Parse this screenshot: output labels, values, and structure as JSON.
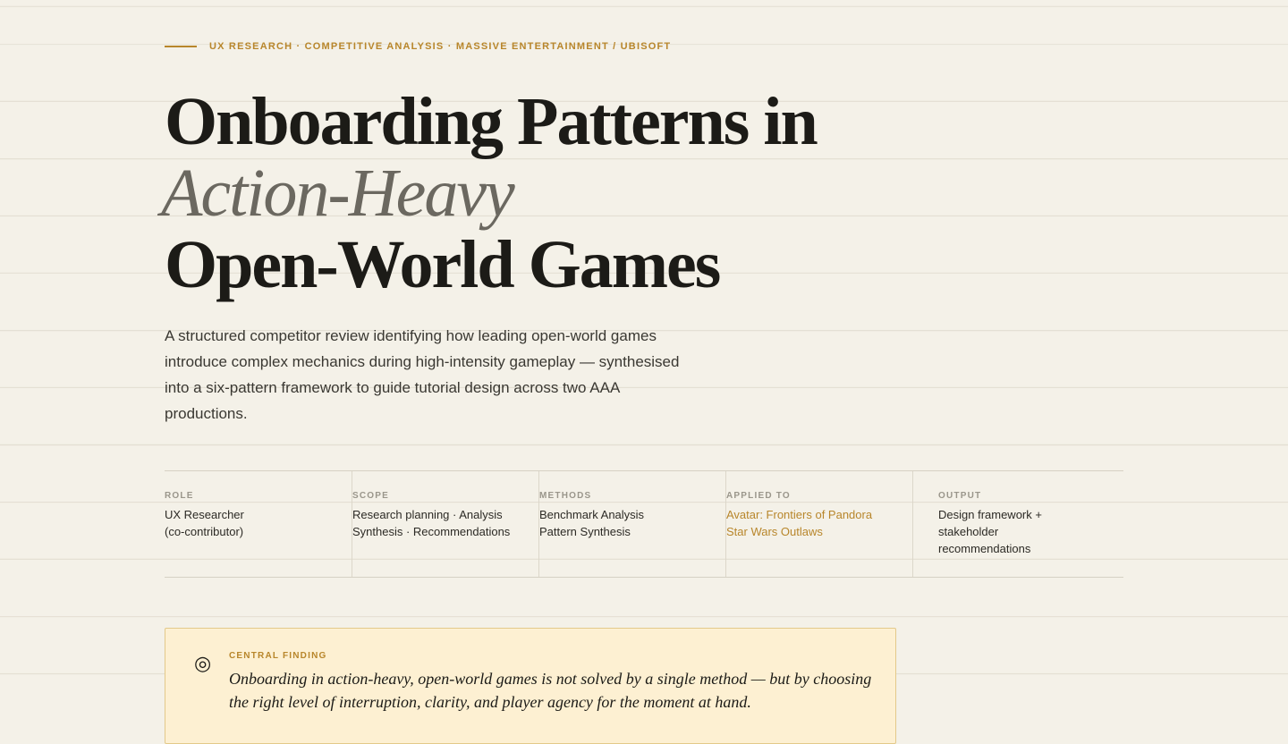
{
  "eyebrow": {
    "text": "UX RESEARCH · COMPETITIVE ANALYSIS · MASSIVE ENTERTAINMENT / UBISOFT"
  },
  "title": {
    "line1": "Onboarding Patterns in",
    "line2": "Action-Heavy",
    "line3": "Open-World Games"
  },
  "lede": "A structured competitor review identifying how leading open-world games introduce complex mechanics during high-intensity gameplay — synthesised into a six-pattern framework to guide tutorial design across two AAA productions.",
  "meta": {
    "role": {
      "label": "ROLE",
      "value": "UX Researcher (co-contributor)"
    },
    "scope": {
      "label": "SCOPE",
      "value": "Research planning · Analysis Synthesis · Recommendations"
    },
    "methods": {
      "label": "METHODS",
      "line1": "Benchmark Analysis",
      "line2": "Pattern Synthesis"
    },
    "applied_to": {
      "label": "APPLIED TO",
      "links": [
        "Avatar: Frontiers of Pandora",
        "Star Wars Outlaws"
      ]
    },
    "output": {
      "label": "OUTPUT",
      "value": "Design framework + stakeholder recommendations"
    }
  },
  "callout": {
    "icon": "target-icon",
    "label": "CENTRAL FINDING",
    "text": "Onboarding in action-heavy, open-world games is not solved by a single method — but by choosing the right level of interruption, clarity, and player agency for the moment at hand."
  },
  "colors": {
    "accent": "#b8862b",
    "background": "#f4f1e8",
    "callout_bg": "#fdf0d2",
    "title": "#1c1b17",
    "title_italic": "#6b6860"
  }
}
